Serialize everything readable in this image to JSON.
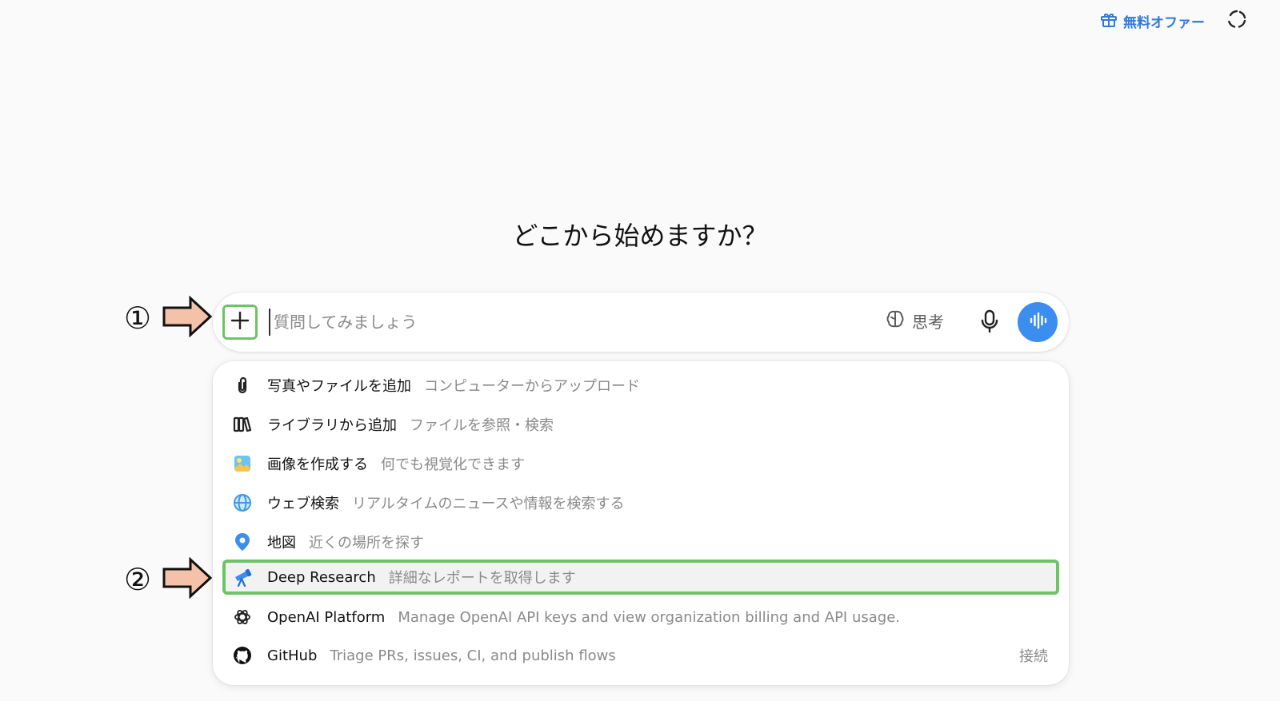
{
  "header": {
    "offer_label": "無料オファー",
    "offer_color": "#2f7ad8"
  },
  "heading": "どこから始めますか？",
  "composer": {
    "placeholder": "質問してみましょう",
    "think_label": "思考",
    "voice_color": "#3b8df0"
  },
  "menu": {
    "items": [
      {
        "label": "写真やファイルを追加",
        "desc": "コンピューターからアップロード",
        "icon": "paperclip-icon"
      },
      {
        "label": "ライブラリから追加",
        "desc": "ファイルを参照・検索",
        "icon": "library-icon"
      },
      {
        "label": "画像を作成する",
        "desc": "何でも視覚化できます",
        "icon": "image-icon"
      },
      {
        "label": "ウェブ検索",
        "desc": "リアルタイムのニュースや情報を検索する",
        "icon": "globe-icon"
      },
      {
        "label": "地図",
        "desc": "近くの場所を探す",
        "icon": "map-pin-icon"
      },
      {
        "label": "Deep Research",
        "desc": "詳細なレポートを取得します",
        "icon": "telescope-icon"
      },
      {
        "label": "OpenAI Platform",
        "desc": "Manage OpenAI API keys and view organization billing and API usage.",
        "icon": "openai-icon"
      },
      {
        "label": "GitHub",
        "desc": "Triage PRs, issues, CI, and publish flows",
        "icon": "github-icon",
        "action": "接続"
      }
    ]
  },
  "annotations": {
    "marker1": "①",
    "marker2": "②",
    "highlight_color": "#6cc565",
    "arrow_color": "#f4c2a8"
  }
}
